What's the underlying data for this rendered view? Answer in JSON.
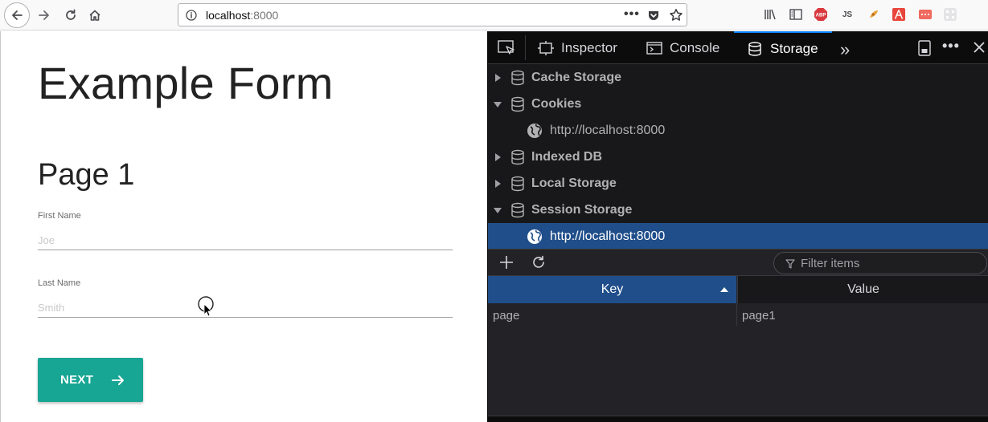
{
  "browser": {
    "url_host": "localhost",
    "url_port": ":8000",
    "page_actions_label": "•••",
    "toolbar_js_label": "JS",
    "toolbar_abp_label": "ABP"
  },
  "page": {
    "form_title": "Example Form",
    "page_title": "Page 1",
    "first_name": {
      "label": "First Name",
      "placeholder": "Joe",
      "value": ""
    },
    "last_name": {
      "label": "Last Name",
      "placeholder": "Smith",
      "value": ""
    },
    "next_button": "NEXT",
    "accent_color": "#17a594"
  },
  "devtools": {
    "tabs": [
      {
        "label": "Inspector",
        "icon": "inspector-icon"
      },
      {
        "label": "Console",
        "icon": "console-icon"
      },
      {
        "label": "Storage",
        "icon": "storage-icon",
        "selected": true
      }
    ],
    "overflow_label": "»",
    "menu_label": "•••",
    "tree": [
      {
        "label": "Cache Storage",
        "expanded": false
      },
      {
        "label": "Cookies",
        "expanded": true,
        "children": [
          "http://localhost:8000"
        ]
      },
      {
        "label": "Indexed DB",
        "expanded": false
      },
      {
        "label": "Local Storage",
        "expanded": false
      },
      {
        "label": "Session Storage",
        "expanded": true,
        "children": [
          "http://localhost:8000"
        ],
        "selected_child": 0
      }
    ],
    "filter_placeholder": "Filter items",
    "columns": {
      "key": "Key",
      "value": "Value"
    },
    "rows": [
      {
        "key": "page",
        "value": "page1"
      }
    ],
    "selection_color": "#204e8a"
  }
}
